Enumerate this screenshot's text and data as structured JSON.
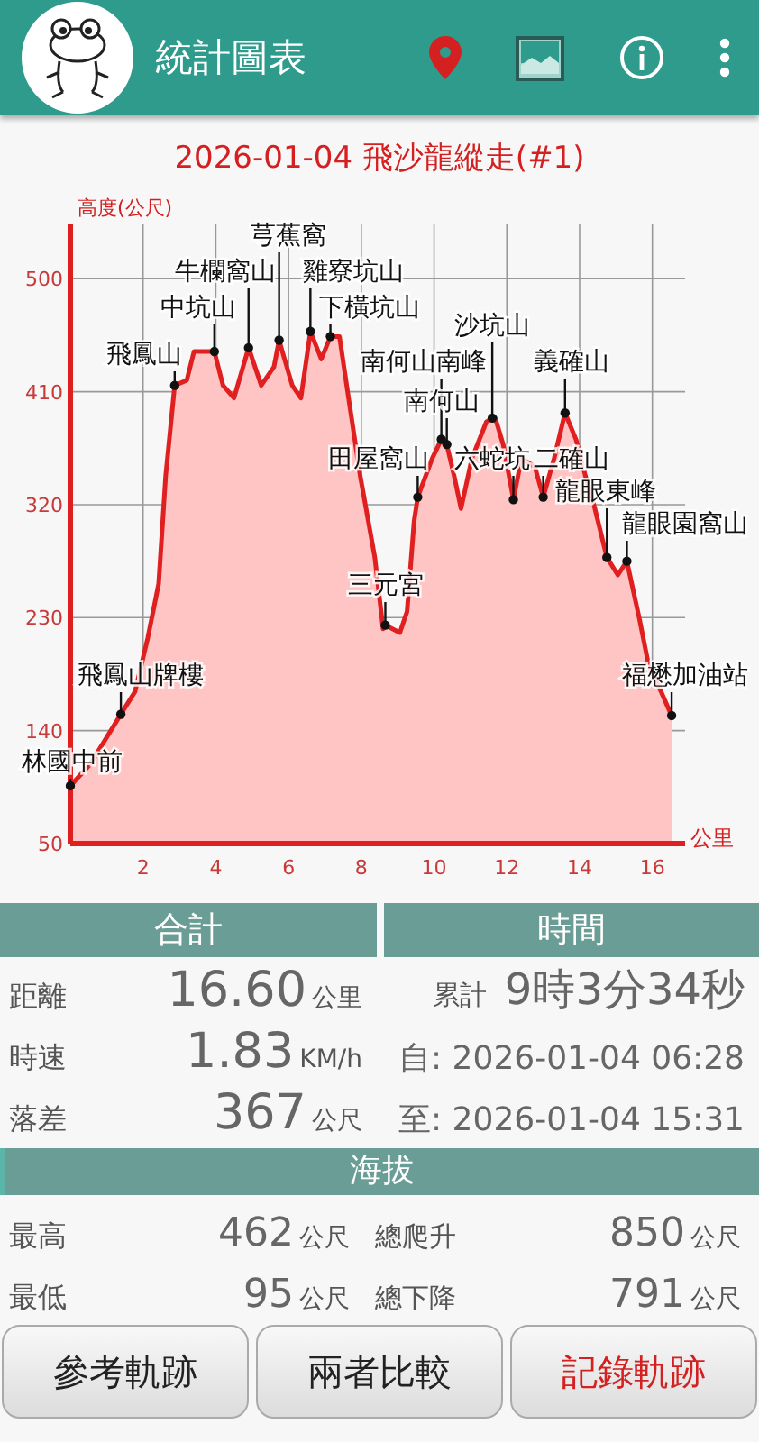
{
  "app_bar": {
    "title": "統計圖表"
  },
  "track_title": "2026-01-04 飛沙龍縱走(#1)",
  "chart": {
    "chart_data": {
      "type": "area",
      "grid": true,
      "ylabel": "高度(公尺)",
      "xlabel": "公里",
      "xlim": [
        0,
        16.9
      ],
      "ylim": [
        50,
        544
      ],
      "xticks": [
        2,
        4,
        6,
        8,
        10,
        12,
        14,
        16
      ],
      "yticks": [
        50,
        140,
        230,
        320,
        410,
        500
      ],
      "x": [
        0,
        0.54,
        1.39,
        1.78,
        2.13,
        2.43,
        2.62,
        2.87,
        3.2,
        3.4,
        3.76,
        3.96,
        4.2,
        4.5,
        4.9,
        5.25,
        5.6,
        5.74,
        6.1,
        6.34,
        6.6,
        6.9,
        7.15,
        7.4,
        7.6,
        7.97,
        8.37,
        8.6,
        8.66,
        9.06,
        9.26,
        9.45,
        9.55,
        9.95,
        10.2,
        10.35,
        10.55,
        10.74,
        11.04,
        11.44,
        11.6,
        11.68,
        11.9,
        12.18,
        12.4,
        12.77,
        13.0,
        13.3,
        13.6,
        13.9,
        14.16,
        14.4,
        14.75,
        15.05,
        15.3,
        15.65,
        15.9,
        16.24,
        16.53
      ],
      "series": [
        {
          "color": "#e02020",
          "values": [
            96,
            113,
            153,
            171,
            214,
            257,
            343,
            415,
            419,
            442,
            442,
            442,
            415,
            405,
            445,
            415,
            430,
            451,
            415,
            405,
            458,
            436,
            454,
            454,
            415,
            343,
            278,
            221,
            224,
            218,
            235,
            307,
            326,
            357,
            372,
            368,
            343,
            317,
            357,
            386,
            389,
            389,
            368,
            324,
            357,
            350,
            326,
            357,
            393,
            372,
            343,
            319,
            278,
            264,
            275,
            228,
            192,
            171,
            152
          ]
        }
      ],
      "annotations": [
        {
          "x": 0,
          "y": 96,
          "text": "林國中前"
        },
        {
          "x": 1.39,
          "y": 153,
          "text": "飛鳳山牌樓"
        },
        {
          "x": 2.87,
          "y": 415,
          "text": "飛鳳山"
        },
        {
          "x": 3.96,
          "y": 442,
          "text": "中坑山"
        },
        {
          "x": 4.9,
          "y": 445,
          "text": "牛欄窩山"
        },
        {
          "x": 5.74,
          "y": 451,
          "text": "芎蕉窩"
        },
        {
          "x": 6.6,
          "y": 458,
          "text": "雞寮坑山"
        },
        {
          "x": 7.15,
          "y": 454,
          "text": "下橫坑山"
        },
        {
          "x": 8.66,
          "y": 224,
          "text": "三元宮"
        },
        {
          "x": 9.55,
          "y": 326,
          "text": "田屋窩山"
        },
        {
          "x": 10.2,
          "y": 372,
          "text": "南何山南峰"
        },
        {
          "x": 10.35,
          "y": 368,
          "text": "南何山"
        },
        {
          "x": 11.6,
          "y": 389,
          "text": "沙坑山"
        },
        {
          "x": 12.18,
          "y": 324,
          "text": "六蛇坑"
        },
        {
          "x": 13.0,
          "y": 326,
          "text": "二確山"
        },
        {
          "x": 13.6,
          "y": 393,
          "text": "義確山"
        },
        {
          "x": 15.3,
          "y": 275,
          "text": "龍眼園窩山"
        },
        {
          "x": 14.75,
          "y": 278,
          "text": "龍眼東峰"
        },
        {
          "x": 16.53,
          "y": 152,
          "text": "福懋加油站"
        }
      ]
    }
  },
  "summary": {
    "headers": [
      "合計",
      "時間"
    ],
    "rows": [
      {
        "label": "距離",
        "value": "16.60",
        "unit": "公里",
        "time_label": "累計",
        "time_value": "9時3分34秒"
      },
      {
        "label": "時速",
        "value": "1.83",
        "unit": "KM/h",
        "time_value": "自: 2026-01-04 06:28"
      },
      {
        "label": "落差",
        "value": "367",
        "unit": "公尺",
        "time_value": "至: 2026-01-04 15:31"
      }
    ]
  },
  "altitude": {
    "header": "海拔",
    "rows": [
      {
        "label": "最高",
        "value": "462",
        "unit": "公尺",
        "label2": "總爬升",
        "value2": "850",
        "unit2": "公尺"
      },
      {
        "label": "最低",
        "value": "95",
        "unit": "公尺",
        "label2": "總下降",
        "value2": "791",
        "unit2": "公尺"
      }
    ]
  },
  "buttons": [
    {
      "label": "參考軌跡",
      "color": "#222222"
    },
    {
      "label": "兩者比較",
      "color": "#222222"
    },
    {
      "label": "記錄軌跡",
      "color": "#d42020"
    }
  ]
}
